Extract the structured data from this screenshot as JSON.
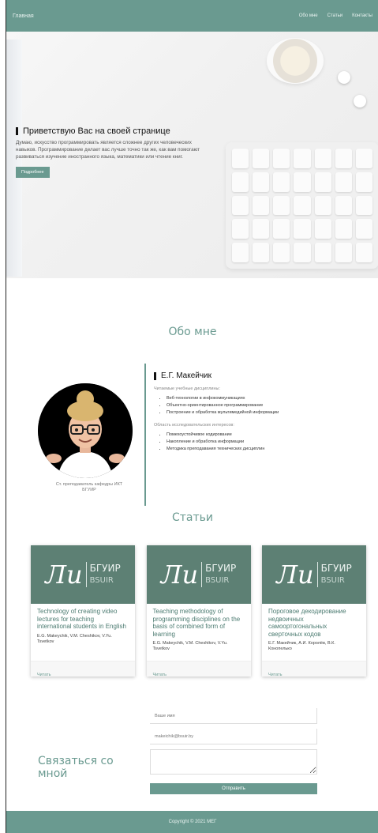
{
  "nav": {
    "brand": "Главная",
    "links": [
      "Обо мне",
      "Статьи",
      "Контакты"
    ]
  },
  "hero": {
    "title": "Приветствую Вас на своей странице",
    "text": "Думаю, искусство программировать является сложнее других человеческих навыков. Программирование делает вас лучше точно так же, как вам помогают развиваться изучение иностранного языка, математики или чтение книг.",
    "button": "Подробнее"
  },
  "about": {
    "heading": "Обо мне",
    "name": "Е.Г. Макейчик",
    "courses_label": "Читаемые учебные дисциплины:",
    "courses": [
      "Веб-технологии в инфокоммуникациях",
      "Объектно-ориентированное программирование",
      "Построение и обработка мультимедийной информации"
    ],
    "interests_label": "Область исследовательских интересов:",
    "interests": [
      "Помехоустойчивое кодирование",
      "Накопление и обработка информации",
      "Методика преподавания технических дисциплин"
    ],
    "caption": "Ст. преподаватель кафедры ИКТ БГУИР"
  },
  "articles": {
    "heading": "Статьи",
    "logo": {
      "mark": "Ли",
      "name": "БГУИР",
      "sub": "BSUIR"
    },
    "read_label": "Читать",
    "items": [
      {
        "title": "Technology of creating video lectures for teaching international students in English",
        "authors": "E.G. Makeychik, V.M. Cheshikov, V.Yu. Tsvetkov"
      },
      {
        "title": "Teaching methodology of programming disciplines on the basis of combined form of learning",
        "authors": "E.G. Makeychik, V.M. Cheshikov, V.Yu. Tsvetkov"
      },
      {
        "title": "Пороговое декодирование недвоичных самоортогональных сверточных кодов",
        "authors": "Е.Г. Макейчик, А.И. Королёв, В.К. Конопелько"
      }
    ]
  },
  "contact": {
    "heading": "Связаться со мной",
    "name_placeholder": "Ваше имя",
    "email_placeholder": "makeichik@bsuir.by",
    "button": "Отправить"
  },
  "footer": {
    "text": "Copyright © 2021 МЕГ"
  }
}
